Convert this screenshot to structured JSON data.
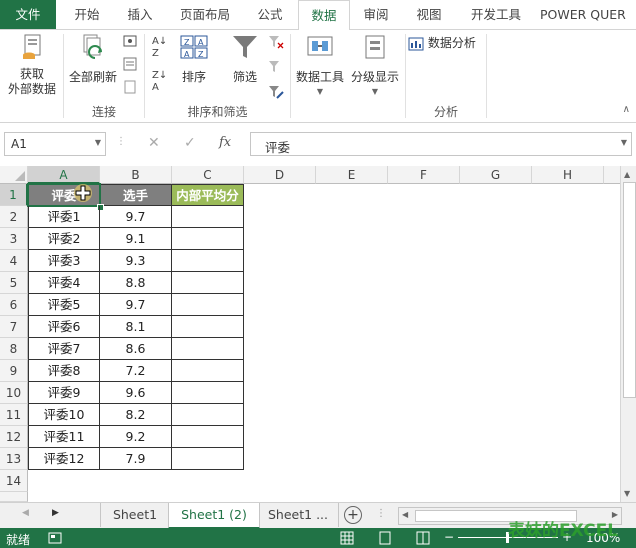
{
  "tabs": [
    {
      "label": "文件"
    },
    {
      "label": "开始"
    },
    {
      "label": "插入"
    },
    {
      "label": "页面布局"
    },
    {
      "label": "公式"
    },
    {
      "label": "数据"
    },
    {
      "label": "审阅"
    },
    {
      "label": "视图"
    },
    {
      "label": "开发工具"
    },
    {
      "label": "POWER QUER"
    }
  ],
  "ribbon": {
    "get_data": {
      "line1": "获取",
      "line2": "外部数据"
    },
    "refresh_all": "全部刷新",
    "sort": "排序",
    "filter": "筛选",
    "data_tools": "数据工具",
    "outline": "分级显示",
    "data_analysis": "数据分析",
    "groups": {
      "connections": "连接",
      "sort_filter": "排序和筛选",
      "analysis": "分析"
    }
  },
  "formula_bar": {
    "name_box": "A1",
    "fx": "fx",
    "formula": "评委"
  },
  "columns": [
    "A",
    "B",
    "C",
    "D",
    "E",
    "F",
    "G",
    "H"
  ],
  "rows": [
    "1",
    "2",
    "3",
    "4",
    "5",
    "6",
    "7",
    "8",
    "9",
    "10",
    "11",
    "12",
    "13",
    "14"
  ],
  "table": {
    "headers": [
      "评委",
      "选手",
      "内部平均分"
    ],
    "rows": [
      [
        "评委1",
        "9.7"
      ],
      [
        "评委2",
        "9.1"
      ],
      [
        "评委3",
        "9.3"
      ],
      [
        "评委4",
        "8.8"
      ],
      [
        "评委5",
        "9.7"
      ],
      [
        "评委6",
        "8.1"
      ],
      [
        "评委7",
        "8.6"
      ],
      [
        "评委8",
        "7.2"
      ],
      [
        "评委9",
        "9.6"
      ],
      [
        "评委10",
        "8.2"
      ],
      [
        "评委11",
        "9.2"
      ],
      [
        "评委12",
        "7.9"
      ]
    ]
  },
  "sheets": [
    {
      "label": "Sheet1"
    },
    {
      "label": "Sheet1 (2)"
    },
    {
      "label": "Sheet1 ..."
    }
  ],
  "status": {
    "ready": "就绪",
    "zoom": "100%",
    "watermark": "表妹的EXCEL"
  },
  "colors": {
    "excel_green": "#217346",
    "header_gray": "#7f7f7f",
    "header_olive": "#9bbb59"
  }
}
